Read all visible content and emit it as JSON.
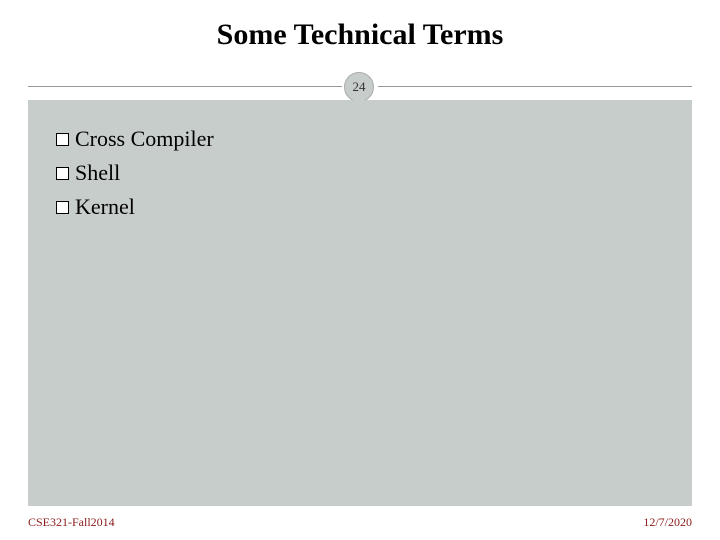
{
  "slide": {
    "title": "Some Technical Terms",
    "number": "24",
    "bullets": [
      "Cross Compiler",
      "Shell",
      "Kernel"
    ],
    "footer_left": "CSE321-Fall2014",
    "footer_right": "12/7/2020"
  }
}
